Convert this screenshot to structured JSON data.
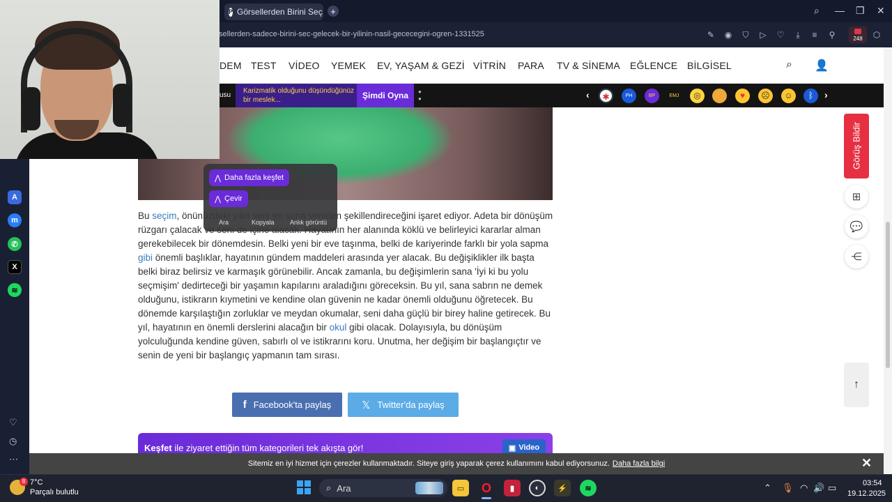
{
  "browser": {
    "tab_title": "Görsellerden Birini Seç, Bi",
    "tab_favicon": "P",
    "url": "sellerden-sadece-birini-sec-gelecek-bir-yilinin-nasil-gececegini-ogren-1331525",
    "extensions_badge": "248",
    "addr_icons": [
      "edit-icon",
      "camera-icon",
      "shield-icon",
      "play-icon",
      "heart-icon",
      "download-icon",
      "menu-icon",
      "pin-icon",
      "cube-icon"
    ]
  },
  "sidebar": {
    "items": [
      "aria-icon",
      "messenger-icon",
      "whatsapp-icon",
      "x-icon",
      "spotify-icon"
    ],
    "bottom": [
      "heart-icon",
      "history-icon",
      "more-icon"
    ]
  },
  "site_nav": {
    "items": [
      "DEM",
      "TEST",
      "VİDEO",
      "YEMEK",
      "EV, YAŞAM & GEZİ",
      "VİTRİN",
      "PARA",
      "TV & SİNEMA",
      "EĞLENCE",
      "BİLGİSEL"
    ]
  },
  "promo": {
    "label": "usu",
    "text": "Karizmatik olduğunu düşündüğünüz bir meslek...",
    "play_label": "Şimdi Oyna"
  },
  "emoji_bar": [
    "target-emoji",
    "philips-emoji",
    "bilpop-emoji",
    "emoji-text",
    "glasses-emoji",
    "cookie-emoji",
    "love-emoji",
    "sad-emoji",
    "smile-emoji",
    "bluetooth-emoji"
  ],
  "popup": {
    "explore": "Daha fazla keşfet",
    "translate": "Çevir",
    "search": "Ara",
    "copy": "Kopyala",
    "screenshot": "Anlık görüntü"
  },
  "article": {
    "p_start": "Bu ",
    "link1": "seçim",
    "p1": ", önünüzdeki yılın seni en sona yeniden şekillendireceğini işaret ediyor. Adeta bir dönüşüm rüzgarı çalacak ve seni de içine alacak. Hayatının her alanında köklü ve belirleyici kararlar alman gerekebilecek bir dönemdesin. Belki yeni bir eve taşınma, belki de kariyerinde farklı bir yola sapma ",
    "link2": "gibi",
    "p2": " önemli başlıklar, hayatının gündem maddeleri arasında yer alacak. Bu değişiklikler ilk başta belki biraz belirsiz ve karmaşık görünebilir. Ancak zamanla, bu değişimlerin sana 'İyi ki bu yolu seçmişim' dedirteceği bir yaşamın kapılarını araladığını göreceksin. Bu yıl, sana sabrın ne demek olduğunu, istikrarın kıymetini ve kendine olan güvenin ne kadar önemli olduğunu öğretecek. Bu dönemde karşılaştığın zorluklar ve meydan okumalar, seni daha güçlü bir birey haline getirecek. Bu yıl, hayatının en önemli derslerini alacağın bir ",
    "link3": "okul",
    "p3": " gibi olacak. Dolayısıyla, bu dönüşüm yolculuğunda kendine güven, sabırlı ol ve istikrarını koru. Unutma, her değişim bir başlangıçtır ve senin de yeni bir başlangıç yapmanın tam sırası."
  },
  "share": {
    "facebook": "Facebook'ta paylaş",
    "twitter": "Twitter'da paylaş"
  },
  "kesfet": {
    "bold": "Keşfet",
    "text": " ile ziyaret ettiğin tüm kategorileri tek akışta gör!",
    "video": "Video"
  },
  "right_actions": {
    "feedback": "Görüş Bildir"
  },
  "cookie": {
    "text": "Sitemiz en iyi hizmet için çerezler kullanmaktadır. Siteye giriş yaparak çerez kullanımını kabul ediyorsunuz.",
    "link": "Daha fazla bilgi"
  },
  "taskbar": {
    "weather_temp": "7°C",
    "weather_desc": "Parçalı bulutlu",
    "weather_badge": "8",
    "search_placeholder": "Ara",
    "time": "03:54",
    "date": "19.12.2025"
  }
}
